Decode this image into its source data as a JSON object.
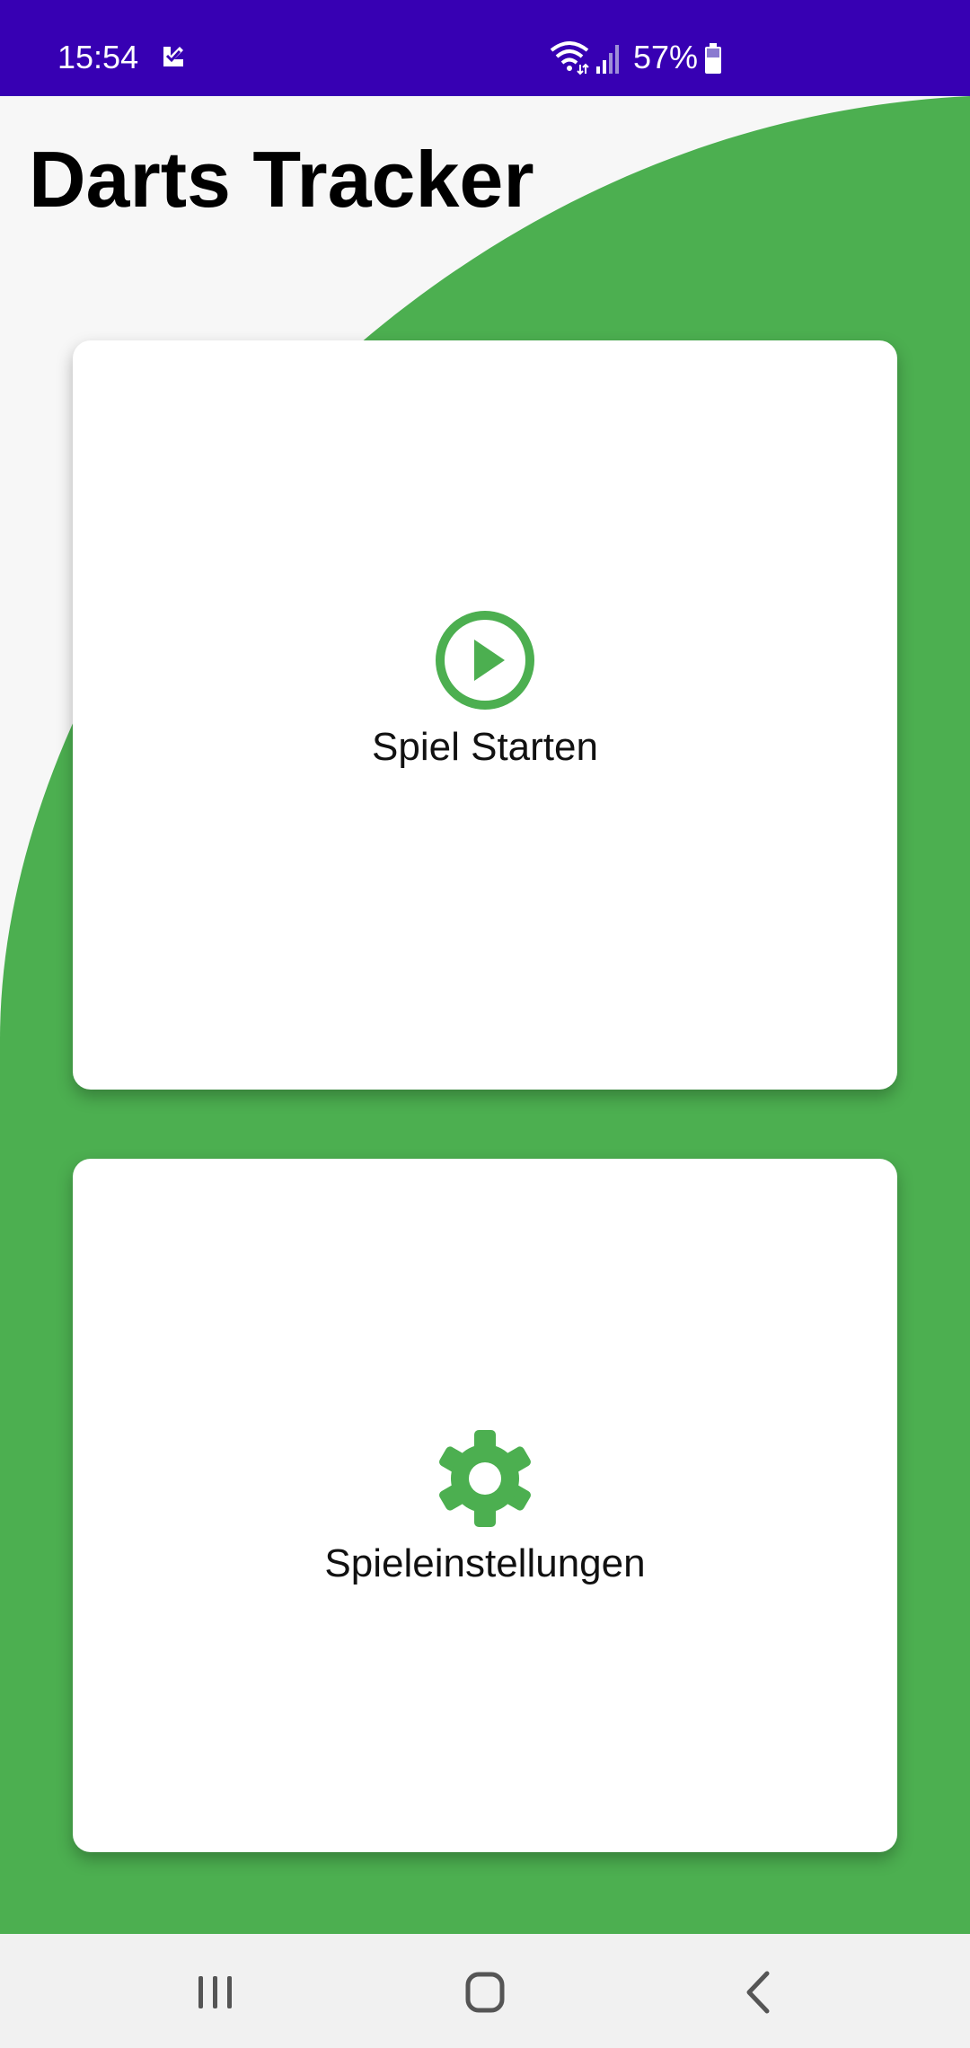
{
  "status_bar": {
    "time": "15:54",
    "battery": "57%",
    "background_color": "#3700b3",
    "icons": [
      "notification-app-icon",
      "wifi-icon",
      "signal-icon",
      "battery-icon"
    ]
  },
  "app": {
    "title": "Darts Tracker",
    "accent_color": "#4caf50"
  },
  "cards": {
    "start": {
      "label": "Spiel Starten",
      "icon": "play-circle-icon"
    },
    "settings": {
      "label": "Spieleinstellungen",
      "icon": "gear-icon"
    }
  },
  "nav_bar": {
    "buttons": [
      "recents-icon",
      "home-icon",
      "back-icon"
    ]
  }
}
